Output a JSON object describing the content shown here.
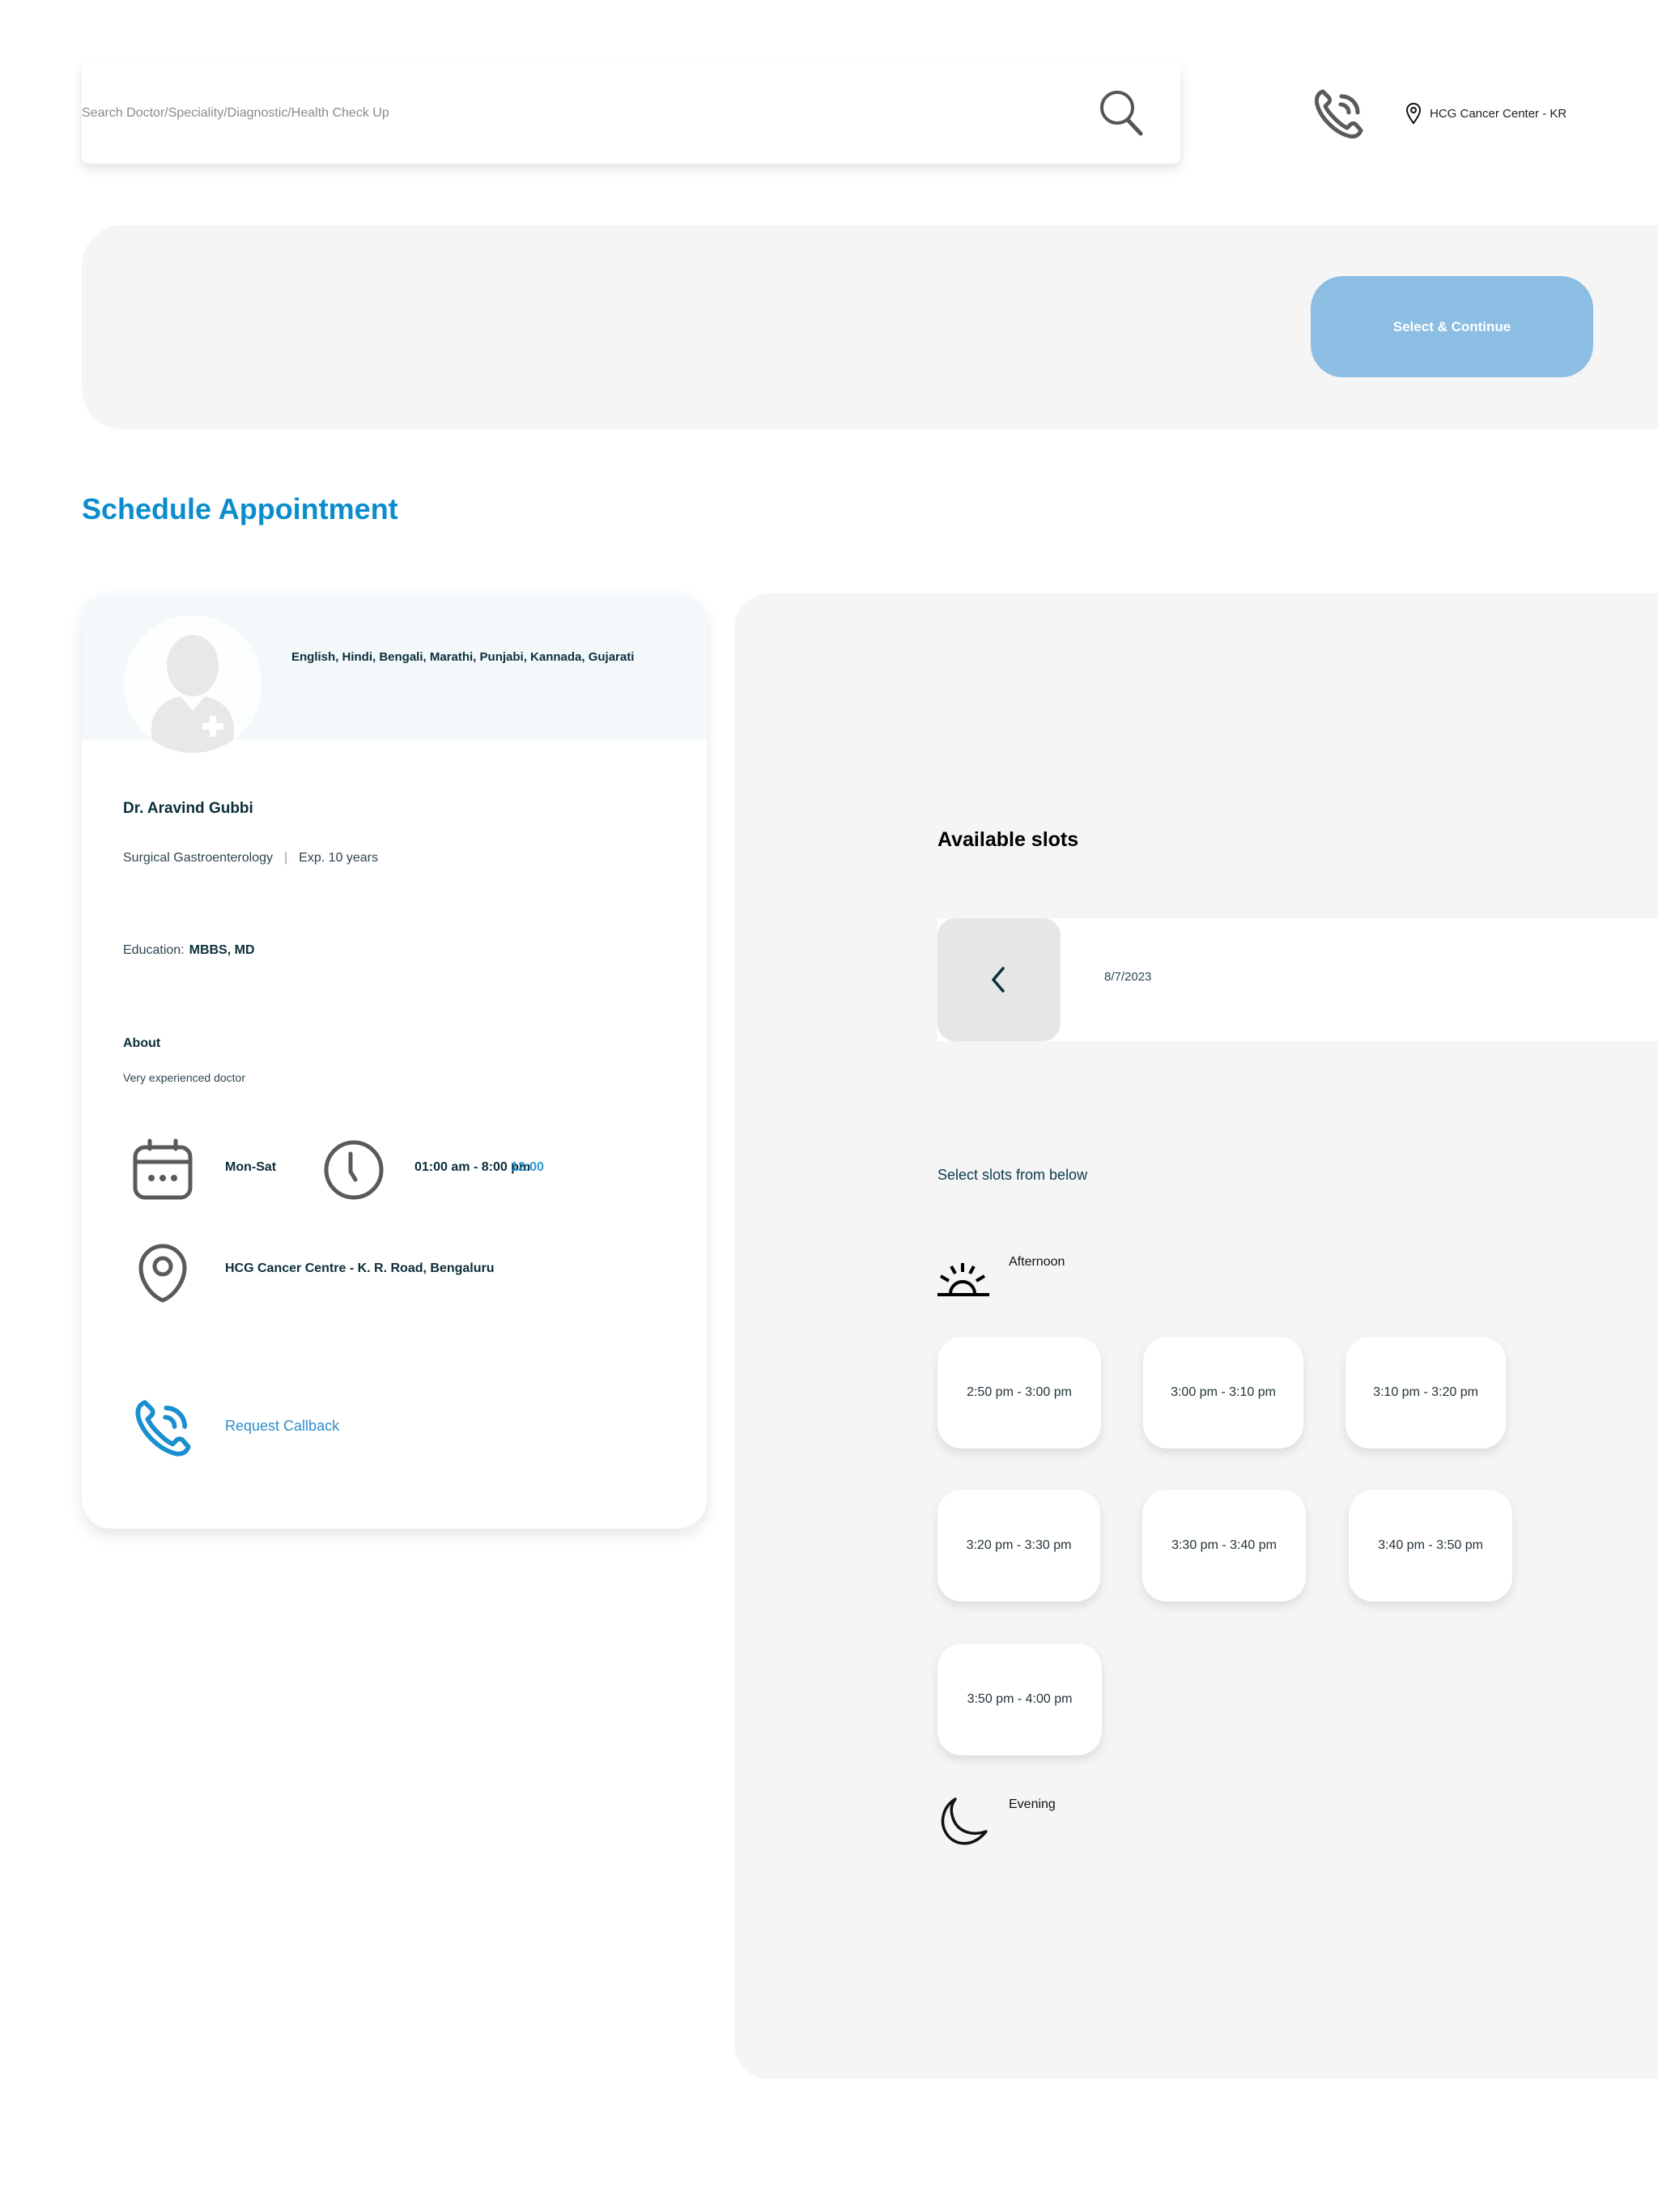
{
  "header": {
    "search_placeholder": "Search Doctor/Speciality/Diagnostic/Health Check Up",
    "search_value": "",
    "location": "HCG Cancer Center - KR"
  },
  "banner": {
    "continue_label": "Select & Continue",
    "continue_color": "#8cbde3"
  },
  "page": {
    "title": "Schedule Appointment",
    "accent_color": "#0a8ccd"
  },
  "doctor": {
    "languages": "English, Hindi, Bengali, Marathi, Punjabi, Kannada, Gujarati",
    "name": "Dr. Aravind Gubbi",
    "speciality": "Surgical Gastroenterology",
    "separator": "|",
    "experience": "Exp. 10 years",
    "education_label": "Education:",
    "education_value": "MBBS, MD",
    "about_heading": "About",
    "about_text": "Very experienced doctor",
    "days": "Mon-Sat",
    "hours": "01:00 am - 8:00 pm",
    "hours_overlay": "12:00",
    "address": "HCG Cancer Centre - K. R. Road, Bengaluru",
    "callback_label": "Request Callback"
  },
  "slots": {
    "title": "Available slots",
    "date": "8/7/2023",
    "hint": "Select slots from below",
    "afternoon": {
      "label": "Afternoon",
      "items": [
        "2:50 pm - 3:00 pm",
        "3:00 pm - 3:10 pm",
        "3:10 pm - 3:20 pm",
        "3:20 pm - 3:30 pm",
        "3:30 pm - 3:40 pm",
        "3:40 pm - 3:50 pm",
        "3:50 pm - 4:00 pm"
      ]
    },
    "evening": {
      "label": "Evening"
    }
  }
}
